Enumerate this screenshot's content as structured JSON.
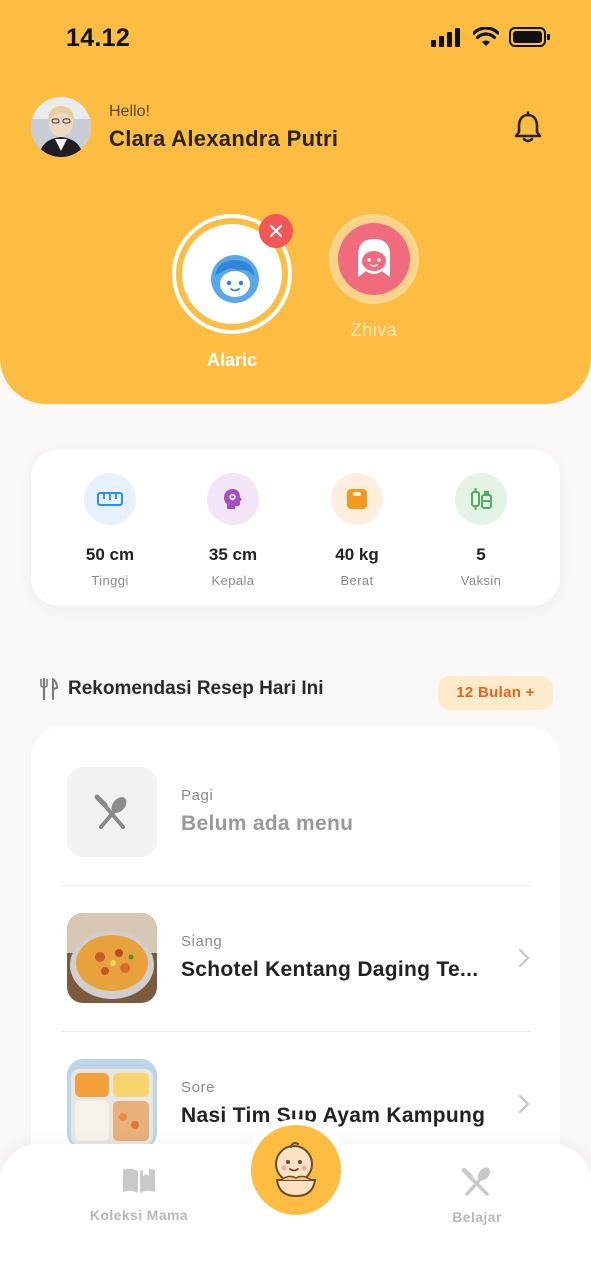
{
  "status_bar": {
    "time": "14.12"
  },
  "user": {
    "greeting": "Hello!",
    "name": "Clara Alexandra Putri"
  },
  "children": [
    {
      "name": "Alaric",
      "selected": true,
      "color": "#5aa8e8"
    },
    {
      "name": "Zhiva",
      "selected": false,
      "color": "#f06b7e"
    }
  ],
  "stats": [
    {
      "value": "50 cm",
      "label": "Tinggi",
      "icon": "ruler-icon",
      "bg": "#e6f1fb",
      "color": "#2f8fe0"
    },
    {
      "value": "35 cm",
      "label": "Kepala",
      "icon": "head-gear-icon",
      "bg": "#f3e4f7",
      "color": "#a54fc4"
    },
    {
      "value": "40 kg",
      "label": "Berat",
      "icon": "scale-icon",
      "bg": "#fdeedd",
      "color": "#f39a1e"
    },
    {
      "value": "5",
      "label": "Vaksin",
      "icon": "vaccine-icon",
      "bg": "#e5f3e7",
      "color": "#4caf5c"
    }
  ],
  "recipes_section": {
    "title": "Rekomendasi Resep Hari Ini",
    "age_badge": "12 Bulan +",
    "items": [
      {
        "time": "Pagi",
        "name": "Belum ada menu"
      },
      {
        "time": "Siang",
        "name": "Schotel Kentang Daging Te..."
      },
      {
        "time": "Sore",
        "name": "Nasi Tim Sup Ayam Kampung"
      }
    ]
  },
  "bottom_nav": {
    "left_label": "Koleksi Mama",
    "right_label": "Belajar"
  },
  "colors": {
    "brand": "#fcbd42",
    "accent": "#e3641b"
  }
}
